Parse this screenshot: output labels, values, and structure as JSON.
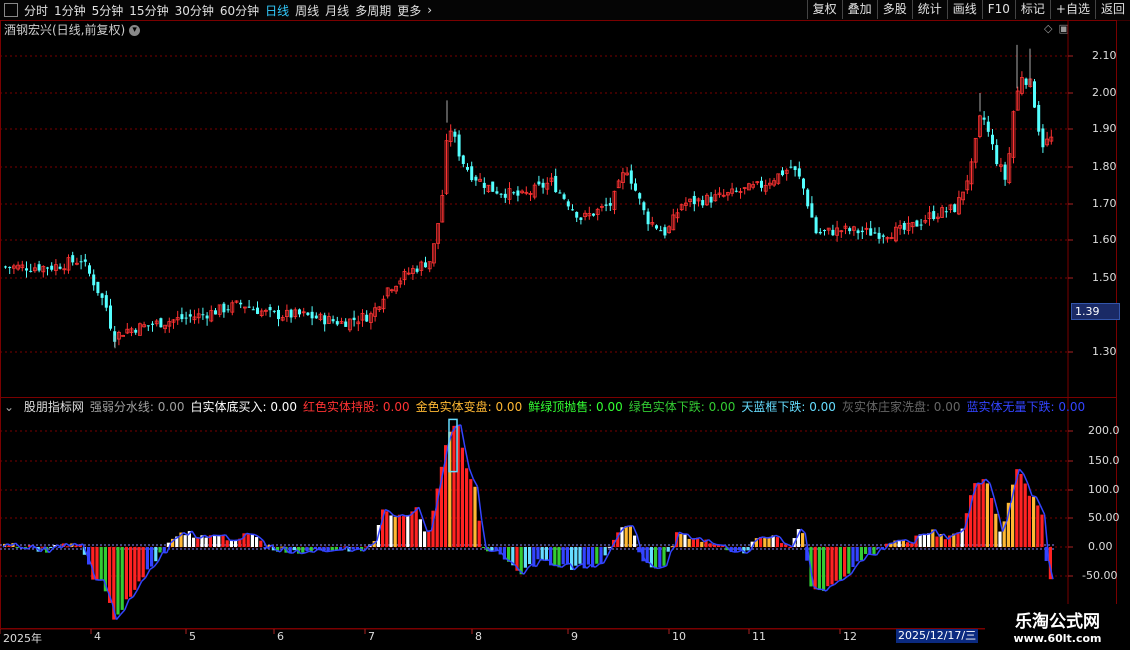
{
  "toolbar": {
    "timeframes": [
      "分时",
      "1分钟",
      "5分钟",
      "15分钟",
      "30分钟",
      "60分钟",
      "日线",
      "周线",
      "月线",
      "多周期",
      "更多"
    ],
    "active": "日线",
    "right_buttons": [
      "复权",
      "叠加",
      "多股",
      "统计",
      "画线",
      "F10",
      "标记",
      "+自选",
      "返回"
    ]
  },
  "chart_title": "酒钢宏兴(日线,前复权)",
  "price_tag": "1.39",
  "indicator": {
    "name": "股朋指标网",
    "items": [
      {
        "label": "强弱分水线: 0.00",
        "color": "#a0a0a0"
      },
      {
        "label": "白实体底买入: 0.00",
        "color": "#ffffff"
      },
      {
        "label": "红色实体持股: 0.00",
        "color": "#ff3333"
      },
      {
        "label": "金色实体变盘: 0.00",
        "color": "#ffb833"
      },
      {
        "label": "鲜绿顶抛售: 0.00",
        "color": "#33ff33"
      },
      {
        "label": "绿色实体下跌: 0.00",
        "color": "#33cc33"
      },
      {
        "label": "天蓝框下跌: 0.00",
        "color": "#66ddff"
      },
      {
        "label": "灰实体庄家洗盘: 0.00",
        "color": "#666666"
      },
      {
        "label": "蓝实体无量下跌: 0.00",
        "color": "#3344ff"
      }
    ]
  },
  "price_axis": [
    "2.10",
    "2.00",
    "1.90",
    "1.80",
    "1.70",
    "1.60",
    "1.50",
    "1.30"
  ],
  "ind_axis": [
    "200.0",
    "150.0",
    "100.0",
    "50.00",
    "0.00",
    "-50.00"
  ],
  "x_axis": [
    "2025年",
    "4",
    "5",
    "6",
    "7",
    "8",
    "9",
    "10",
    "11",
    "12"
  ],
  "date_tag": "2025/12/17/三",
  "watermark": {
    "title": "乐淘公式网",
    "url": "www.60lt.com"
  },
  "colors": {
    "up": "#ff3333",
    "down": "#54ffff",
    "grid": "#7a0000"
  }
}
